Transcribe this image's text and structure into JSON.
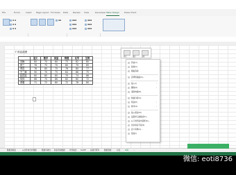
{
  "ribbon_tabs": [
    "File",
    "Home",
    "Insert",
    "Page Layout",
    "Formulas",
    "Data",
    "Review",
    "View",
    "Developer",
    "Table Design",
    "Power Pivot"
  ],
  "active_tab": "Table Design",
  "caption": "F 科目成绩",
  "table": {
    "headers": [
      "",
      "语文",
      "数学",
      "英语",
      "物理",
      "化学",
      "生物"
    ],
    "rows": [
      [
        "刘梅",
        "80",
        "70",
        "80",
        "73",
        "82",
        "80"
      ],
      [
        "张三",
        "76",
        "75",
        "70",
        "80",
        "79",
        "85"
      ],
      [
        "李四",
        "78",
        "80",
        "75",
        "76",
        "80",
        "77"
      ],
      [
        "王二麻",
        "90",
        "70",
        "75",
        "84",
        "88",
        "75"
      ],
      [
        "赵四娃",
        "80",
        "80",
        "80",
        "70",
        "74",
        "86"
      ],
      [
        "何伟",
        "68",
        "70",
        "86",
        "80",
        "80",
        "72"
      ],
      [
        "黄珊",
        "71",
        "72",
        "80",
        "72",
        "78",
        "80"
      ]
    ]
  },
  "minibar": [
    "样式",
    "填充",
    "边框"
  ],
  "context_menu": [
    {
      "label": "剪切(T)",
      "submenu": false
    },
    {
      "label": "复制(C)",
      "submenu": false
    },
    {
      "label": "粘贴选项:",
      "submenu": false
    },
    {
      "label": "",
      "sep": true
    },
    {
      "label": "选择性粘贴(S)...",
      "submenu": false
    },
    {
      "label": "",
      "sep": true
    },
    {
      "label": "插入(I)",
      "submenu": true
    },
    {
      "label": "删除(D)",
      "submenu": true
    },
    {
      "label": "清除内容(N)",
      "submenu": false
    },
    {
      "label": "",
      "sep": true
    },
    {
      "label": "快速分析(Q)",
      "submenu": false
    },
    {
      "label": "筛选(E)",
      "submenu": true
    },
    {
      "label": "排序(O)",
      "submenu": true
    },
    {
      "label": "",
      "sep": true
    },
    {
      "label": "插入批注(M)",
      "submenu": false
    },
    {
      "label": "设置单元格格式(F)...",
      "submenu": false
    },
    {
      "label": "从下拉列表中选择(K)...",
      "submenu": false
    },
    {
      "label": "显示拼音字段(S)",
      "submenu": false
    },
    {
      "label": "定义名称(A)...",
      "submenu": false
    },
    {
      "label": "链接(I)",
      "submenu": false
    }
  ],
  "sheet_tabs": [
    "数据透视表",
    "从文件夹合并数据",
    "数据有效性",
    "跨表查询数据",
    "条件格式",
    "SUMIF",
    "表格行转列",
    "数据透视",
    "对比",
    "成绩",
    "..."
  ],
  "active_sheet": "成绩",
  "watermark": "微信: eoti8736",
  "colors": {
    "excel_green": "#217346"
  }
}
